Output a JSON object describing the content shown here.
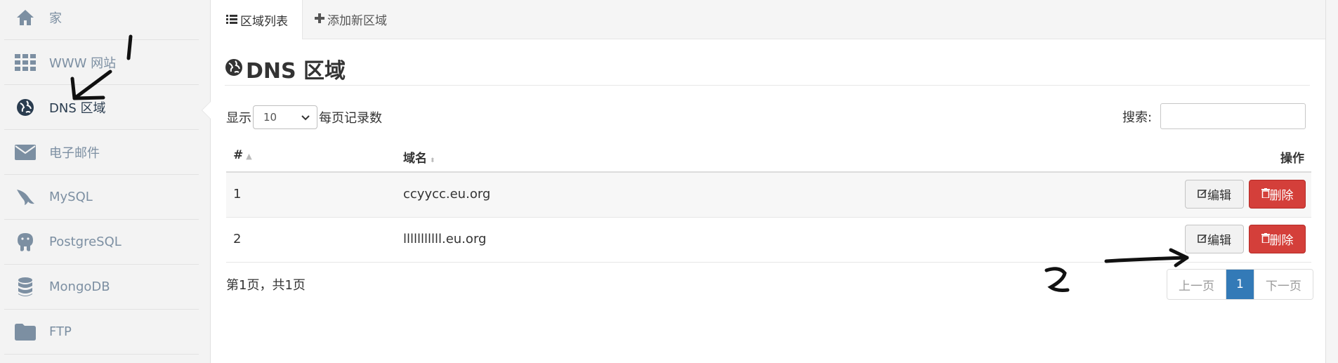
{
  "sidebar": {
    "items": [
      {
        "label": "家",
        "icon": "home-icon"
      },
      {
        "label": "WWW 网站",
        "icon": "grid-icon"
      },
      {
        "label": "DNS 区域",
        "icon": "globe-icon",
        "active": true
      },
      {
        "label": "电子邮件",
        "icon": "envelope-icon"
      },
      {
        "label": "MySQL",
        "icon": "dolphin-icon"
      },
      {
        "label": "PostgreSQL",
        "icon": "elephant-icon"
      },
      {
        "label": "MongoDB",
        "icon": "database-icon"
      },
      {
        "label": "FTP",
        "icon": "folder-icon"
      }
    ]
  },
  "tabs": [
    {
      "label": "区域列表",
      "icon": "list-icon",
      "active": true
    },
    {
      "label": "添加新区域",
      "icon": "plus-icon"
    }
  ],
  "page_title": "DNS 区域",
  "controls": {
    "show_label": "显示",
    "per_page_value": "10",
    "per_page_suffix": "每页记录数",
    "search_label": "搜索:"
  },
  "table": {
    "headers": [
      "#",
      "域名",
      "操作"
    ],
    "rows": [
      {
        "num": "1",
        "domain": "ccyycc.eu.org"
      },
      {
        "num": "2",
        "domain": "lllllllllll.eu.org"
      }
    ],
    "edit_label": "编辑",
    "delete_label": "删除"
  },
  "footer": {
    "info": "第1页，共1页",
    "prev": "上一页",
    "current": "1",
    "next": "下一页"
  },
  "annotations": {
    "mark_1": "1",
    "mark_2": "2"
  },
  "colors": {
    "accent": "#337ab7",
    "danger": "#d43f3a",
    "sidebar_text": "#7c8fa2"
  }
}
